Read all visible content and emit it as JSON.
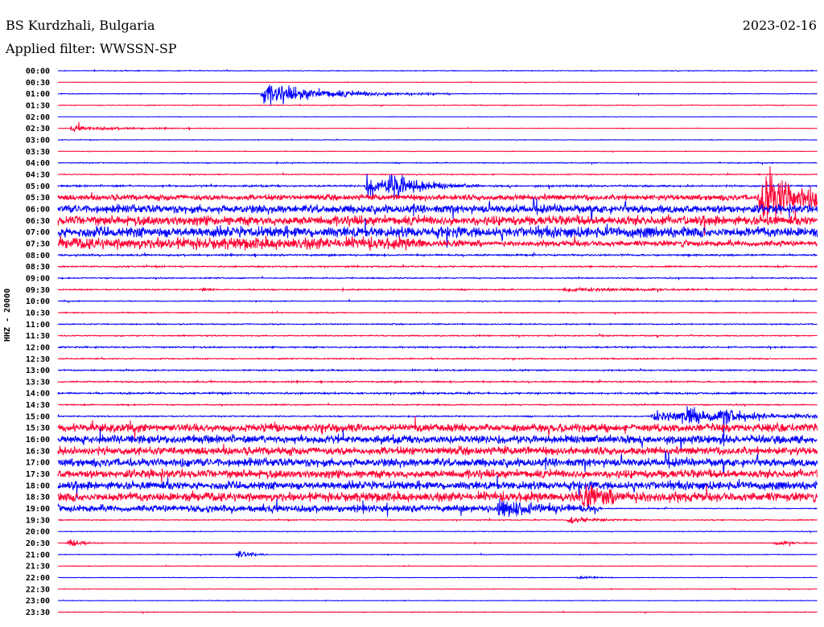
{
  "header": {
    "station": "BS Kurdzhali, Bulgaria",
    "date": "2023-02-16",
    "filter": "Applied filter: WWSSN-SP"
  },
  "chart_data": {
    "type": "line",
    "title": "BS Kurdzhali, Bulgaria",
    "ylabel": "HHZ - 20000",
    "minutes_per_line": 30,
    "colors": [
      "#0000ff",
      "#ff0033"
    ],
    "rows": [
      {
        "label": "00:00",
        "noise": 0.6,
        "events": []
      },
      {
        "label": "00:30",
        "noise": 0.4,
        "events": []
      },
      {
        "label": "01:00",
        "noise": 0.6,
        "events": [
          {
            "minute": 8.1,
            "amp": 18,
            "dur": 2.5
          }
        ]
      },
      {
        "label": "01:30",
        "noise": 0.6,
        "events": []
      },
      {
        "label": "02:00",
        "noise": 0.4,
        "events": []
      },
      {
        "label": "02:30",
        "noise": 0.5,
        "events": [
          {
            "minute": 0.5,
            "amp": 4,
            "dur": 2
          }
        ]
      },
      {
        "label": "03:00",
        "noise": 0.5,
        "events": []
      },
      {
        "label": "03:30",
        "noise": 0.5,
        "events": []
      },
      {
        "label": "04:00",
        "noise": 0.8,
        "events": []
      },
      {
        "label": "04:30",
        "noise": 0.8,
        "events": []
      },
      {
        "label": "05:00",
        "noise": 1.5,
        "events": [
          {
            "minute": 12.2,
            "amp": 20,
            "dur": 0.8
          },
          {
            "minute": 13.1,
            "amp": 22,
            "dur": 1.2
          }
        ]
      },
      {
        "label": "05:30",
        "noise": 5,
        "events": [
          {
            "minute": 27.8,
            "amp": 60,
            "dur": 1.2
          }
        ]
      },
      {
        "label": "06:00",
        "noise": 7,
        "events": []
      },
      {
        "label": "06:30",
        "noise": 8,
        "events": []
      },
      {
        "label": "07:00",
        "noise": 9,
        "events": []
      },
      {
        "label": "07:30",
        "noise": 10,
        "events": []
      },
      {
        "label": "08:00",
        "noise": 1.5,
        "events": []
      },
      {
        "label": "08:30",
        "noise": 1.2,
        "events": []
      },
      {
        "label": "09:00",
        "noise": 1,
        "events": []
      },
      {
        "label": "09:30",
        "noise": 1,
        "events": [
          {
            "minute": 5.7,
            "amp": 6,
            "dur": 0.2
          },
          {
            "minute": 20,
            "amp": 3,
            "dur": 3
          }
        ]
      },
      {
        "label": "10:00",
        "noise": 0.8,
        "events": []
      },
      {
        "label": "10:30",
        "noise": 0.8,
        "events": []
      },
      {
        "label": "11:00",
        "noise": 1,
        "events": []
      },
      {
        "label": "11:30",
        "noise": 1,
        "events": []
      },
      {
        "label": "12:00",
        "noise": 1.2,
        "events": []
      },
      {
        "label": "12:30",
        "noise": 1,
        "events": []
      },
      {
        "label": "13:00",
        "noise": 1.2,
        "events": []
      },
      {
        "label": "13:30",
        "noise": 1.2,
        "events": []
      },
      {
        "label": "14:00",
        "noise": 1.5,
        "events": []
      },
      {
        "label": "14:30",
        "noise": 1,
        "events": []
      },
      {
        "label": "15:00",
        "noise": 1,
        "events": [
          {
            "minute": 23.5,
            "amp": 8,
            "dur": 6
          },
          {
            "minute": 24.7,
            "amp": 16,
            "dur": 0.6
          },
          {
            "minute": 26.2,
            "amp": 16,
            "dur": 0.6
          }
        ]
      },
      {
        "label": "15:30",
        "noise": 7,
        "events": []
      },
      {
        "label": "16:00",
        "noise": 7,
        "events": []
      },
      {
        "label": "16:30",
        "noise": 7,
        "events": []
      },
      {
        "label": "17:00",
        "noise": 7,
        "events": []
      },
      {
        "label": "17:30",
        "noise": 7,
        "events": []
      },
      {
        "label": "18:00",
        "noise": 7,
        "events": []
      },
      {
        "label": "18:30",
        "noise": 8,
        "events": [
          {
            "minute": 20.7,
            "amp": 12,
            "dur": 1.5
          }
        ]
      },
      {
        "label": "19:00",
        "noise": 6,
        "events": [
          {
            "minute": 17.4,
            "amp": 14,
            "dur": 1.2
          }
        ]
      },
      {
        "label": "19:30",
        "noise": 0.8,
        "events": [
          {
            "minute": 20.2,
            "amp": 6,
            "dur": 1
          }
        ]
      },
      {
        "label": "20:00",
        "noise": 0.6,
        "events": []
      },
      {
        "label": "20:30",
        "noise": 0.6,
        "events": [
          {
            "minute": 0.4,
            "amp": 8,
            "dur": 0.5
          },
          {
            "minute": 28.3,
            "amp": 3,
            "dur": 1
          }
        ]
      },
      {
        "label": "21:00",
        "noise": 0.6,
        "events": [
          {
            "minute": 7.1,
            "amp": 10,
            "dur": 0.4
          }
        ]
      },
      {
        "label": "21:30",
        "noise": 0.5,
        "events": []
      },
      {
        "label": "22:00",
        "noise": 0.5,
        "events": [
          {
            "minute": 20.6,
            "amp": 3,
            "dur": 0.5
          }
        ]
      },
      {
        "label": "22:30",
        "noise": 0.5,
        "events": []
      },
      {
        "label": "23:00",
        "noise": 0.5,
        "events": []
      },
      {
        "label": "23:30",
        "noise": 0.6,
        "events": []
      }
    ]
  }
}
